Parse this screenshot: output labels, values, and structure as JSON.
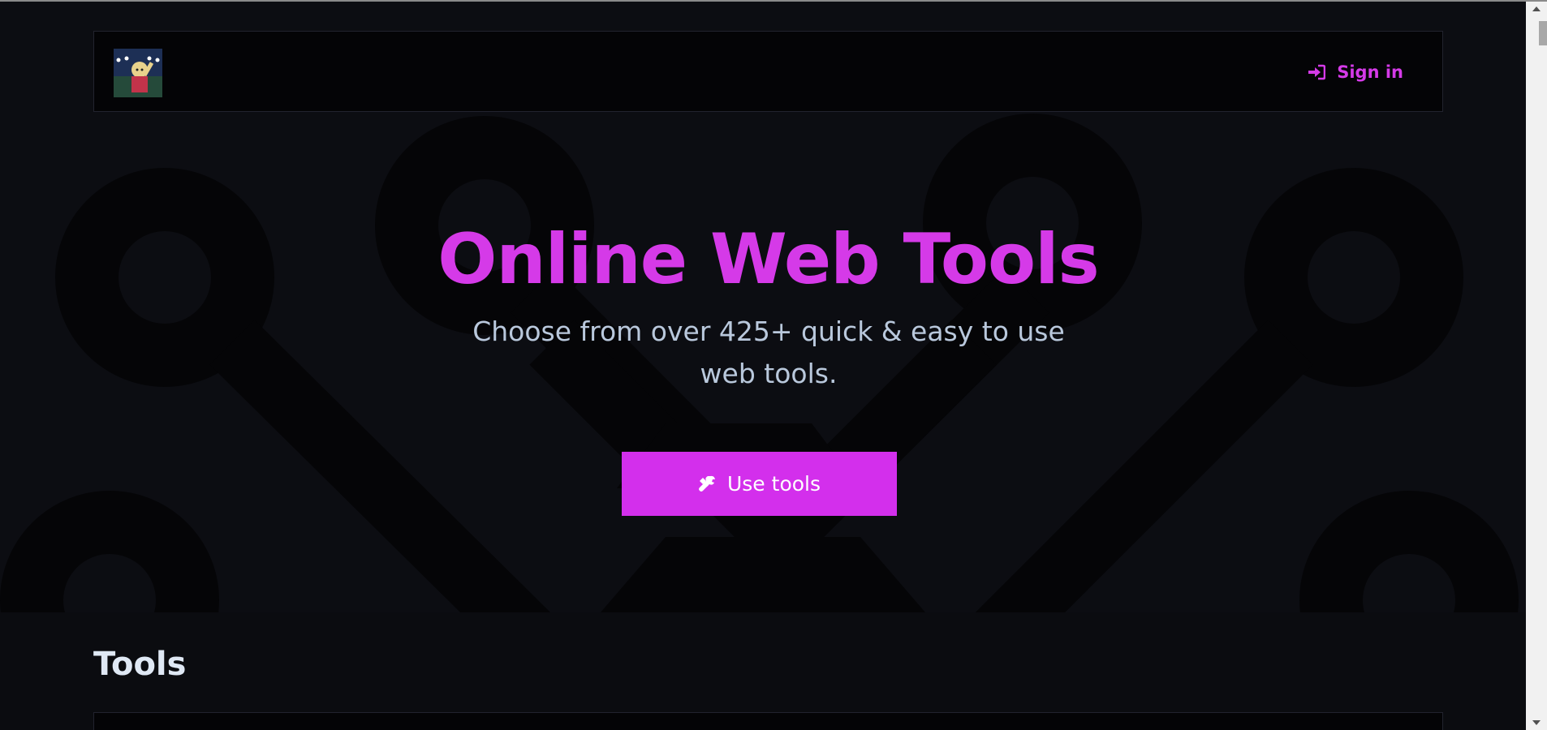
{
  "header": {
    "logo_icon": "anime-avatar-logo",
    "signin_icon": "sign-in-icon",
    "signin_label": "Sign in"
  },
  "hero": {
    "title": "Online Web Tools",
    "subtitle": "Choose from over 425+ quick & easy to use web tools.",
    "cta_icon": "tools-icon",
    "cta_label": "Use tools"
  },
  "tools_section": {
    "title": "Tools"
  },
  "colors": {
    "accent": "#d53ae8",
    "button": "#d32fec",
    "background": "#0c0d12",
    "subtitle": "#b9c8dc"
  }
}
